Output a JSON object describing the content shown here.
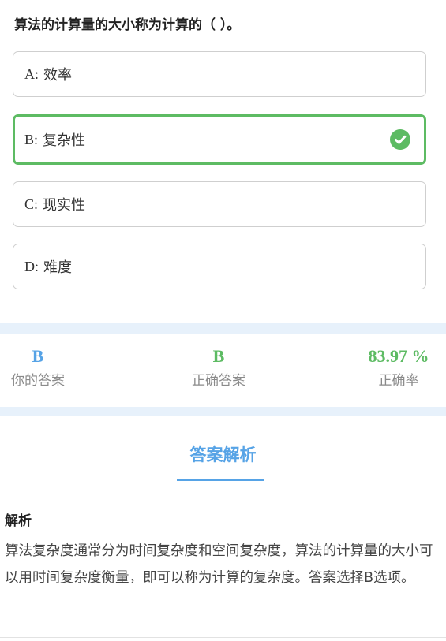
{
  "question": {
    "text": "算法的计算量的大小称为计算的（ ）。"
  },
  "options": [
    {
      "letter": "A:",
      "text": "效率",
      "correct": false
    },
    {
      "letter": "B:",
      "text": "复杂性",
      "correct": true
    },
    {
      "letter": "C:",
      "text": "现实性",
      "correct": false
    },
    {
      "letter": "D:",
      "text": "难度",
      "correct": false
    }
  ],
  "stats": {
    "your_answer": {
      "value": "B",
      "label": "你的答案",
      "color": "#56a3e6"
    },
    "correct_answer": {
      "value": "B",
      "label": "正确答案",
      "color": "#5dbb63"
    },
    "accuracy": {
      "value": "83.97 %",
      "label": "正确率",
      "color": "#5dbb63"
    }
  },
  "analysis": {
    "section_title": "答案解析",
    "heading": "解析",
    "body": "算法复杂度通常分为时间复杂度和空间复杂度，算法的计算量的大小可以用时间复杂度衡量，即可以称为计算的复杂度。答案选择B选项。"
  },
  "icons": {
    "correct_mark": "check-circle-icon"
  },
  "colors": {
    "accent_blue": "#56a3e6",
    "correct_green": "#5dbb63",
    "band": "#e7f1fb"
  }
}
